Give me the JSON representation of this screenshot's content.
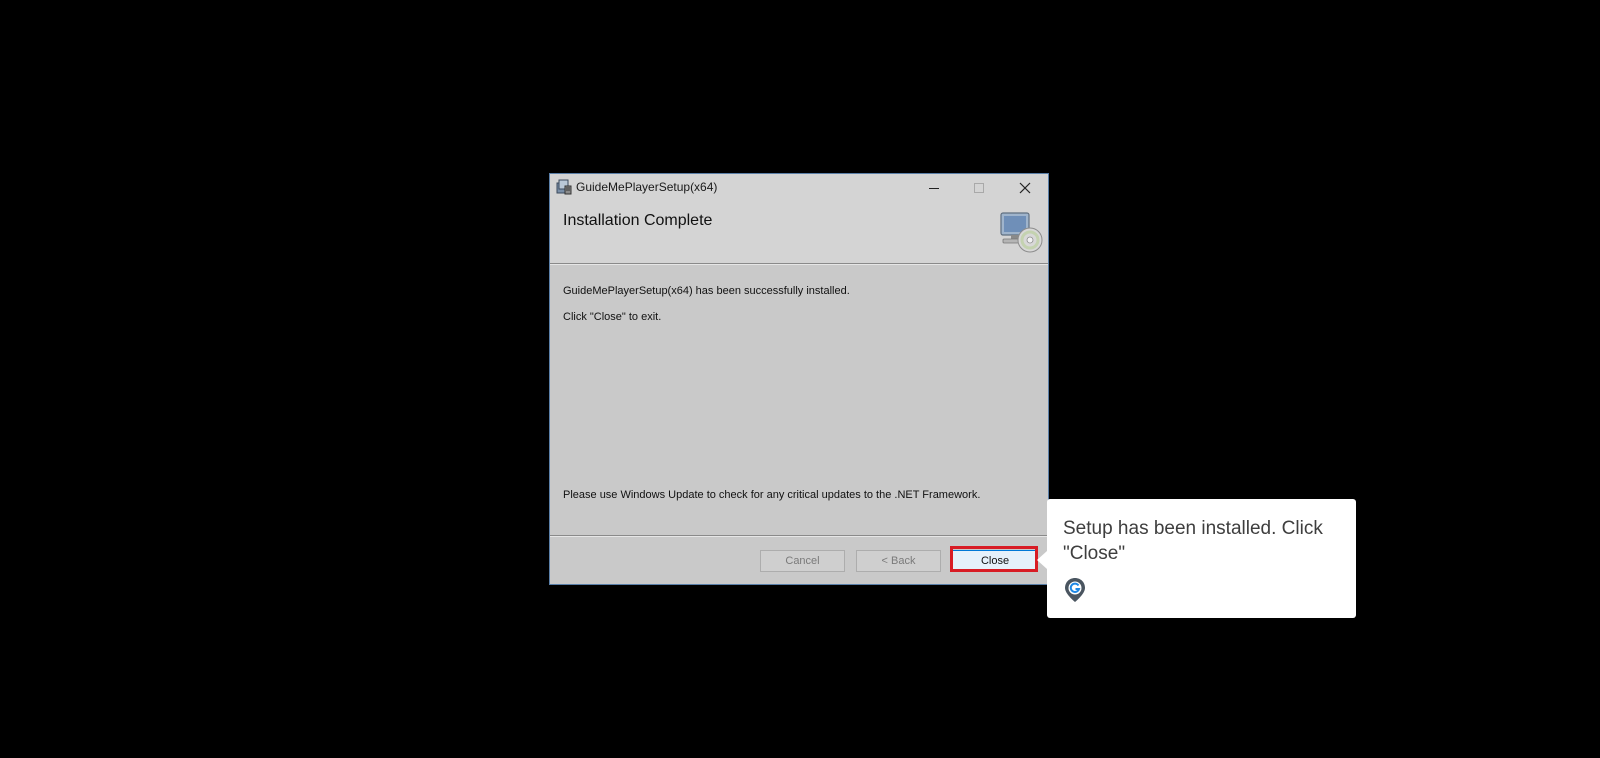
{
  "window": {
    "title": "GuideMePlayerSetup(x64)",
    "controls": {
      "minimize": "minimize-icon",
      "maximize": "maximize-icon",
      "close": "close-icon"
    }
  },
  "header": {
    "title": "Installation Complete",
    "icon": "computer-cd-icon"
  },
  "body": {
    "message_installed": "GuideMePlayerSetup(x64) has been successfully installed.",
    "message_exit": "Click \"Close\" to exit.",
    "message_update": "Please use Windows Update to check for any critical updates to the .NET Framework."
  },
  "buttons": {
    "cancel": "Cancel",
    "back": "< Back",
    "close": "Close"
  },
  "tooltip": {
    "text": "Setup has been installed. Click \"Close\"",
    "icon": "guideme-pin-icon"
  },
  "colors": {
    "highlight": "#d81c25",
    "primary_button_border": "#0078d7",
    "dialog_background": "#c9c9c9"
  }
}
